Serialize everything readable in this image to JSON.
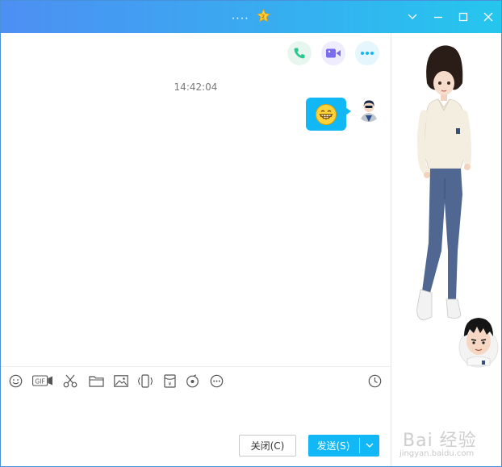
{
  "window": {
    "title": "....",
    "title_badge_icon": "gold-star-icon",
    "controls": {
      "dropdown_icon": "chevron-down-icon",
      "minimize_icon": "minimize-icon",
      "maximize_icon": "maximize-icon",
      "close_icon": "close-icon"
    }
  },
  "chat": {
    "top_actions": [
      {
        "icon": "phone-icon",
        "color": "#29c78f",
        "bg": "#e7f7f0"
      },
      {
        "icon": "video-camera-icon",
        "color": "#7b6cf2",
        "bg": "#eeecfd"
      },
      {
        "icon": "more-dots-icon",
        "color": "#12b7f5",
        "bg": "#e5f6fd"
      }
    ],
    "messages": [
      {
        "timestamp": "14:42:04",
        "from": "me",
        "content_icon": "grinning-emoji-icon"
      }
    ],
    "bubble_color": "#12b7f5"
  },
  "toolbar": {
    "left_icons": [
      "emoji-icon",
      "gif-icon",
      "scissors-icon",
      "folder-icon",
      "image-icon",
      "shake-icon",
      "red-packet-icon",
      "music-icon",
      "more-icon"
    ],
    "gif_label": "GIF",
    "right_icon": "history-clock-icon"
  },
  "compose": {
    "value": ""
  },
  "buttons": {
    "close_label": "关闭(C)",
    "send_label": "发送(S)",
    "send_dropdown_icon": "chevron-down-icon",
    "accent": "#12b7f5"
  },
  "side": {
    "character_full": "girl-avatar-show",
    "character_small": "boy-avatar-head"
  },
  "watermark": {
    "text": "Bai 经验",
    "url": "jingyan.baidu.com"
  }
}
